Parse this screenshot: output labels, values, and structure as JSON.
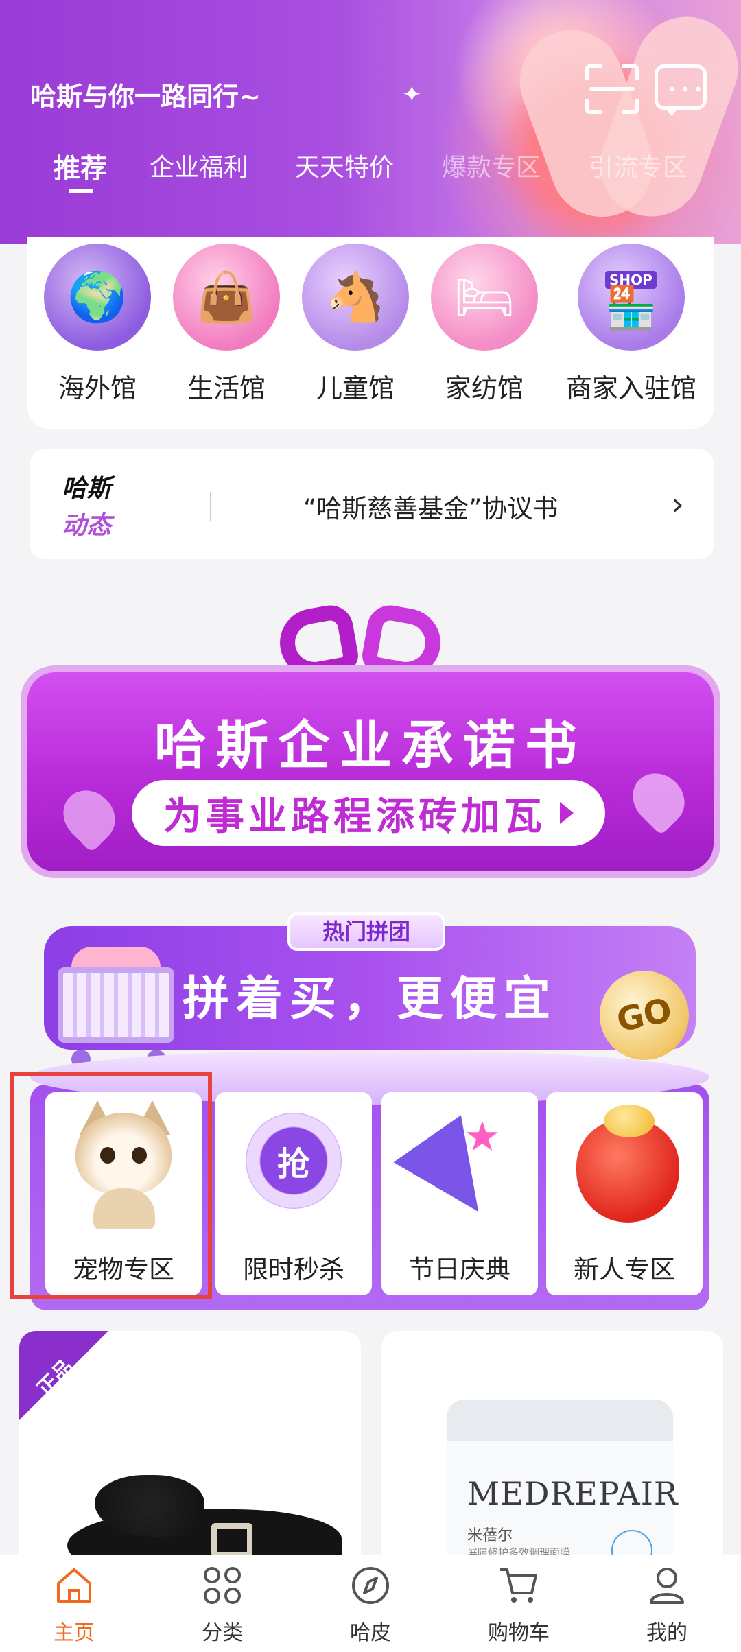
{
  "header": {
    "brand": "哈斯与你一路同行~",
    "tabs": [
      "推荐",
      "企业福利",
      "天天特价",
      "爆款专区",
      "引流专区"
    ],
    "active_tab": "推荐"
  },
  "venues": [
    "海外馆",
    "生活馆",
    "儿童馆",
    "家纺馆",
    "商家入驻馆"
  ],
  "venue_icons": [
    "globe-icon",
    "shopping-bag-icon",
    "rocking-horse-icon",
    "bed-icon",
    "shop-icon"
  ],
  "shop_icon_text": "SHOP",
  "news": {
    "label_line1": "哈斯",
    "label_line2": "动态",
    "headline": "“哈斯慈善基金”协议书"
  },
  "promise_banner": {
    "title": "哈斯企业承诺书",
    "button": "为事业路程添砖加瓦"
  },
  "group_buy": {
    "tag": "热门拼团",
    "slogan": "拼着买，更便宜",
    "go": "GO",
    "clock_text": "抢",
    "items": [
      "宠物专区",
      "限时秒杀",
      "节日庆典",
      "新人专区"
    ]
  },
  "products": {
    "p1_ribbon": "正品",
    "p2_brand": "MEDREPAIR",
    "p2_cn": "米蓓尔",
    "p2_desc": "屏障修护多效调理面膜"
  },
  "bottom_nav": [
    {
      "label": "主页",
      "icon": "home-icon"
    },
    {
      "label": "分类",
      "icon": "category-icon"
    },
    {
      "label": "哈皮",
      "icon": "compass-icon"
    },
    {
      "label": "购物车",
      "icon": "cart-icon"
    },
    {
      "label": "我的",
      "icon": "profile-icon"
    }
  ],
  "colors": {
    "primary": "#a84ee0",
    "active_nav": "#f06a1f",
    "highlight": "#e8423f"
  }
}
